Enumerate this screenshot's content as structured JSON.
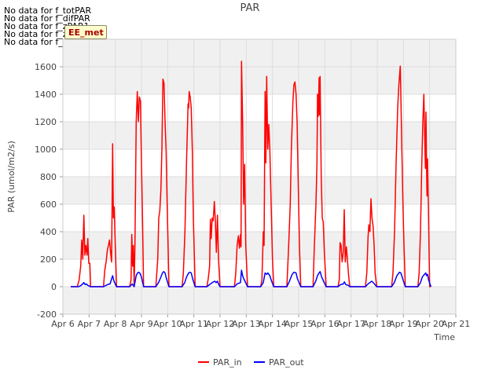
{
  "notices": [
    "No data for f_totPAR",
    "No data for f_difPAR",
    "No data for f_zPAR1",
    "No data for f_zPAR2",
    "No data for f_zPAR3"
  ],
  "badge": {
    "label": "EE_met"
  },
  "colors": {
    "par_in": "#ff0000",
    "par_out": "#0000ff",
    "band": "#f0f0f0",
    "grid": "#dddddd"
  },
  "chart_data": {
    "type": "line",
    "title": "PAR",
    "xlabel": "Time",
    "ylabel": "PAR (umol/m2/s)",
    "xlim": [
      6,
      21
    ],
    "ylim": [
      -200,
      1800
    ],
    "yticks": [
      -200,
      0,
      200,
      400,
      600,
      800,
      1000,
      1200,
      1400,
      1600
    ],
    "xticks": [
      {
        "v": 6,
        "label": "Apr 6"
      },
      {
        "v": 7,
        "label": "Apr 7"
      },
      {
        "v": 8,
        "label": "Apr 8"
      },
      {
        "v": 9,
        "label": "Apr 9"
      },
      {
        "v": 10,
        "label": "Apr 10"
      },
      {
        "v": 11,
        "label": "Apr 11"
      },
      {
        "v": 12,
        "label": "Apr 12"
      },
      {
        "v": 13,
        "label": "Apr 13"
      },
      {
        "v": 14,
        "label": "Apr 14"
      },
      {
        "v": 15,
        "label": "Apr 15"
      },
      {
        "v": 16,
        "label": "Apr 16"
      },
      {
        "v": 17,
        "label": "Apr 17"
      },
      {
        "v": 18,
        "label": "Apr 18"
      },
      {
        "v": 19,
        "label": "Apr 19"
      },
      {
        "v": 20,
        "label": "Apr 20"
      },
      {
        "v": 21,
        "label": "Apr 21"
      }
    ],
    "grid": true,
    "legend": "bottom-center",
    "series": [
      {
        "name": "PAR_in",
        "color": "#ff0000",
        "points": [
          [
            6.3,
            0
          ],
          [
            6.55,
            0
          ],
          [
            6.62,
            50
          ],
          [
            6.68,
            150
          ],
          [
            6.72,
            340
          ],
          [
            6.76,
            200
          ],
          [
            6.8,
            520
          ],
          [
            6.84,
            230
          ],
          [
            6.88,
            300
          ],
          [
            6.92,
            230
          ],
          [
            6.95,
            350
          ],
          [
            6.99,
            170
          ],
          [
            7.03,
            170
          ],
          [
            7.06,
            0
          ],
          [
            7.55,
            0
          ],
          [
            7.6,
            120
          ],
          [
            7.65,
            180
          ],
          [
            7.7,
            270
          ],
          [
            7.74,
            300
          ],
          [
            7.78,
            340
          ],
          [
            7.82,
            250
          ],
          [
            7.86,
            180
          ],
          [
            7.9,
            1040
          ],
          [
            7.93,
            500
          ],
          [
            7.96,
            580
          ],
          [
            8.0,
            300
          ],
          [
            8.05,
            0
          ],
          [
            8.55,
            0
          ],
          [
            8.6,
            50
          ],
          [
            8.63,
            380
          ],
          [
            8.66,
            150
          ],
          [
            8.69,
            300
          ],
          [
            8.72,
            0
          ],
          [
            8.75,
            300
          ],
          [
            8.8,
            1200
          ],
          [
            8.84,
            1420
          ],
          [
            8.88,
            1200
          ],
          [
            8.92,
            1380
          ],
          [
            8.96,
            1350
          ],
          [
            9.0,
            900
          ],
          [
            9.04,
            500
          ],
          [
            9.08,
            0
          ],
          [
            9.55,
            0
          ],
          [
            9.62,
            200
          ],
          [
            9.66,
            500
          ],
          [
            9.7,
            550
          ],
          [
            9.74,
            700
          ],
          [
            9.78,
            1000
          ],
          [
            9.82,
            1510
          ],
          [
            9.86,
            1480
          ],
          [
            9.9,
            1200
          ],
          [
            9.94,
            1000
          ],
          [
            9.98,
            600
          ],
          [
            10.05,
            0
          ],
          [
            10.55,
            0
          ],
          [
            10.6,
            100
          ],
          [
            10.66,
            400
          ],
          [
            10.72,
            900
          ],
          [
            10.76,
            1200
          ],
          [
            10.78,
            1330
          ],
          [
            10.8,
            1300
          ],
          [
            10.82,
            1420
          ],
          [
            10.86,
            1380
          ],
          [
            10.9,
            1300
          ],
          [
            10.94,
            1000
          ],
          [
            10.98,
            500
          ],
          [
            11.05,
            0
          ],
          [
            11.5,
            0
          ],
          [
            11.55,
            60
          ],
          [
            11.6,
            150
          ],
          [
            11.63,
            490
          ],
          [
            11.66,
            350
          ],
          [
            11.7,
            500
          ],
          [
            11.74,
            480
          ],
          [
            11.78,
            620
          ],
          [
            11.82,
            480
          ],
          [
            11.86,
            250
          ],
          [
            11.9,
            520
          ],
          [
            11.94,
            200
          ],
          [
            12.0,
            0
          ],
          [
            12.55,
            0
          ],
          [
            12.6,
            100
          ],
          [
            12.65,
            300
          ],
          [
            12.7,
            370
          ],
          [
            12.74,
            280
          ],
          [
            12.78,
            380
          ],
          [
            12.8,
            290
          ],
          [
            12.82,
            1640
          ],
          [
            12.86,
            1200
          ],
          [
            12.9,
            600
          ],
          [
            12.94,
            890
          ],
          [
            12.98,
            300
          ],
          [
            13.05,
            0
          ],
          [
            13.55,
            0
          ],
          [
            13.6,
            50
          ],
          [
            13.65,
            400
          ],
          [
            13.68,
            300
          ],
          [
            13.72,
            1420
          ],
          [
            13.75,
            900
          ],
          [
            13.78,
            1530
          ],
          [
            13.82,
            1000
          ],
          [
            13.86,
            1180
          ],
          [
            13.9,
            1000
          ],
          [
            13.95,
            600
          ],
          [
            14.0,
            200
          ],
          [
            14.05,
            0
          ],
          [
            14.55,
            0
          ],
          [
            14.62,
            300
          ],
          [
            14.68,
            600
          ],
          [
            14.72,
            1000
          ],
          [
            14.78,
            1350
          ],
          [
            14.82,
            1470
          ],
          [
            14.86,
            1490
          ],
          [
            14.9,
            1400
          ],
          [
            14.94,
            1200
          ],
          [
            14.98,
            800
          ],
          [
            15.03,
            300
          ],
          [
            15.08,
            0
          ],
          [
            15.55,
            0
          ],
          [
            15.6,
            300
          ],
          [
            15.66,
            600
          ],
          [
            15.7,
            900
          ],
          [
            15.72,
            1400
          ],
          [
            15.75,
            1240
          ],
          [
            15.78,
            1520
          ],
          [
            15.8,
            1250
          ],
          [
            15.82,
            1530
          ],
          [
            15.86,
            800
          ],
          [
            15.9,
            500
          ],
          [
            15.94,
            470
          ],
          [
            15.98,
            250
          ],
          [
            16.05,
            0
          ],
          [
            16.5,
            0
          ],
          [
            16.55,
            50
          ],
          [
            16.58,
            320
          ],
          [
            16.62,
            300
          ],
          [
            16.66,
            180
          ],
          [
            16.7,
            250
          ],
          [
            16.74,
            560
          ],
          [
            16.78,
            180
          ],
          [
            16.82,
            290
          ],
          [
            16.86,
            200
          ],
          [
            16.9,
            100
          ],
          [
            16.95,
            0
          ],
          [
            17.55,
            0
          ],
          [
            17.6,
            100
          ],
          [
            17.65,
            360
          ],
          [
            17.68,
            450
          ],
          [
            17.72,
            400
          ],
          [
            17.76,
            640
          ],
          [
            17.8,
            500
          ],
          [
            17.84,
            440
          ],
          [
            17.88,
            300
          ],
          [
            17.92,
            100
          ],
          [
            17.98,
            0
          ],
          [
            18.55,
            0
          ],
          [
            18.6,
            100
          ],
          [
            18.66,
            400
          ],
          [
            18.72,
            900
          ],
          [
            18.78,
            1300
          ],
          [
            18.82,
            1450
          ],
          [
            18.86,
            1560
          ],
          [
            18.88,
            1605
          ],
          [
            18.9,
            1400
          ],
          [
            18.94,
            1000
          ],
          [
            18.98,
            600
          ],
          [
            19.02,
            300
          ],
          [
            19.07,
            0
          ],
          [
            19.55,
            0
          ],
          [
            19.6,
            100
          ],
          [
            19.65,
            400
          ],
          [
            19.7,
            900
          ],
          [
            19.74,
            1200
          ],
          [
            19.78,
            1400
          ],
          [
            19.82,
            1000
          ],
          [
            19.84,
            860
          ],
          [
            19.86,
            1270
          ],
          [
            19.88,
            900
          ],
          [
            19.9,
            660
          ],
          [
            19.92,
            930
          ],
          [
            19.96,
            500
          ],
          [
            19.98,
            230
          ],
          [
            20.0,
            0
          ],
          [
            20.05,
            0
          ]
        ]
      },
      {
        "name": "PAR_out",
        "color": "#0000ff",
        "points": [
          [
            6.3,
            0
          ],
          [
            6.6,
            0
          ],
          [
            6.7,
            10
          ],
          [
            6.8,
            30
          ],
          [
            6.85,
            15
          ],
          [
            6.9,
            20
          ],
          [
            6.95,
            10
          ],
          [
            7.05,
            0
          ],
          [
            7.55,
            0
          ],
          [
            7.7,
            15
          ],
          [
            7.8,
            20
          ],
          [
            7.9,
            80
          ],
          [
            7.95,
            40
          ],
          [
            8.05,
            0
          ],
          [
            8.55,
            0
          ],
          [
            8.65,
            20
          ],
          [
            8.72,
            0
          ],
          [
            8.8,
            80
          ],
          [
            8.85,
            100
          ],
          [
            8.9,
            105
          ],
          [
            8.95,
            95
          ],
          [
            9.0,
            70
          ],
          [
            9.08,
            0
          ],
          [
            9.55,
            0
          ],
          [
            9.65,
            30
          ],
          [
            9.72,
            60
          ],
          [
            9.8,
            100
          ],
          [
            9.85,
            110
          ],
          [
            9.9,
            100
          ],
          [
            9.95,
            60
          ],
          [
            10.05,
            0
          ],
          [
            10.55,
            0
          ],
          [
            10.65,
            30
          ],
          [
            10.72,
            70
          ],
          [
            10.8,
            100
          ],
          [
            10.85,
            105
          ],
          [
            10.9,
            100
          ],
          [
            10.95,
            60
          ],
          [
            11.05,
            0
          ],
          [
            11.5,
            0
          ],
          [
            11.6,
            15
          ],
          [
            11.7,
            30
          ],
          [
            11.8,
            40
          ],
          [
            11.85,
            30
          ],
          [
            11.9,
            40
          ],
          [
            11.95,
            15
          ],
          [
            12.0,
            0
          ],
          [
            12.55,
            0
          ],
          [
            12.65,
            20
          ],
          [
            12.78,
            30
          ],
          [
            12.82,
            120
          ],
          [
            12.86,
            80
          ],
          [
            12.9,
            60
          ],
          [
            12.95,
            40
          ],
          [
            13.05,
            0
          ],
          [
            13.55,
            0
          ],
          [
            13.65,
            30
          ],
          [
            13.72,
            100
          ],
          [
            13.78,
            90
          ],
          [
            13.82,
            100
          ],
          [
            13.9,
            80
          ],
          [
            13.95,
            50
          ],
          [
            14.05,
            0
          ],
          [
            14.55,
            0
          ],
          [
            14.65,
            40
          ],
          [
            14.75,
            90
          ],
          [
            14.82,
            105
          ],
          [
            14.9,
            100
          ],
          [
            14.95,
            60
          ],
          [
            15.08,
            0
          ],
          [
            15.55,
            0
          ],
          [
            15.65,
            40
          ],
          [
            15.72,
            80
          ],
          [
            15.78,
            100
          ],
          [
            15.82,
            110
          ],
          [
            15.88,
            70
          ],
          [
            15.95,
            40
          ],
          [
            16.05,
            0
          ],
          [
            16.5,
            0
          ],
          [
            16.6,
            15
          ],
          [
            16.7,
            20
          ],
          [
            16.75,
            35
          ],
          [
            16.8,
            15
          ],
          [
            16.9,
            10
          ],
          [
            16.95,
            0
          ],
          [
            17.55,
            0
          ],
          [
            17.65,
            20
          ],
          [
            17.72,
            30
          ],
          [
            17.78,
            40
          ],
          [
            17.85,
            30
          ],
          [
            17.98,
            0
          ],
          [
            18.55,
            0
          ],
          [
            18.65,
            30
          ],
          [
            18.75,
            80
          ],
          [
            18.85,
            105
          ],
          [
            18.9,
            100
          ],
          [
            18.95,
            70
          ],
          [
            19.07,
            0
          ],
          [
            19.55,
            0
          ],
          [
            19.65,
            30
          ],
          [
            19.72,
            70
          ],
          [
            19.8,
            90
          ],
          [
            19.85,
            100
          ],
          [
            19.88,
            80
          ],
          [
            19.92,
            90
          ],
          [
            19.96,
            50
          ],
          [
            20.05,
            0
          ]
        ]
      }
    ]
  }
}
